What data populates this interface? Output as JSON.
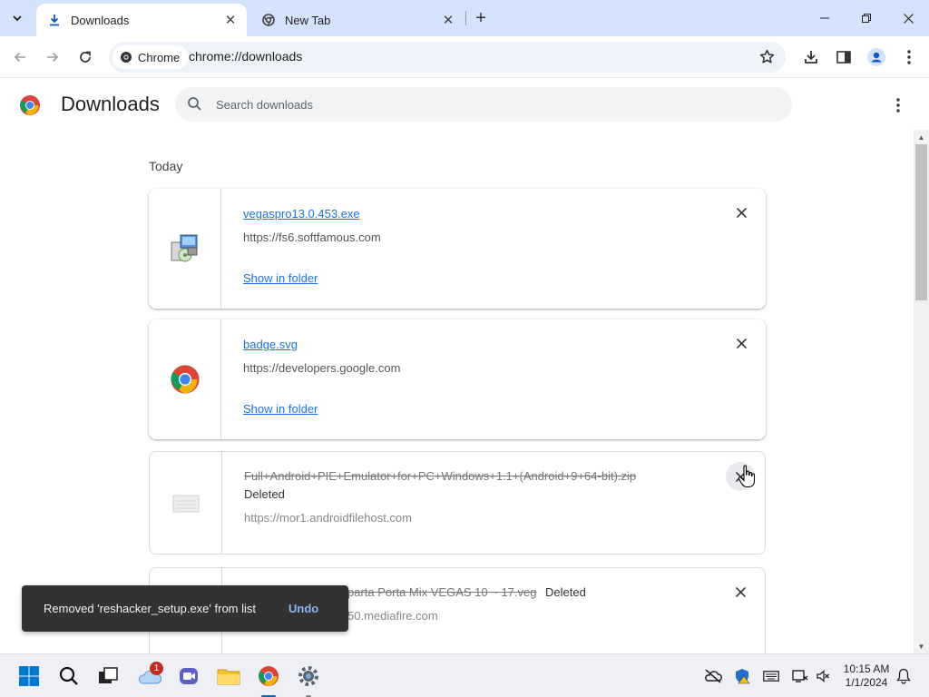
{
  "browser": {
    "tabs": [
      {
        "title": "Downloads",
        "active": true
      },
      {
        "title": "New Tab",
        "active": false
      }
    ],
    "omnibox": {
      "chip_label": "Chrome",
      "url": "chrome://downloads"
    }
  },
  "downloads_page": {
    "title": "Downloads",
    "search_placeholder": "Search downloads",
    "section_label": "Today",
    "items": [
      {
        "filename": "vegaspro13.0.453.exe",
        "source": "https://fs6.softfamous.com",
        "action": "Show in folder",
        "icon": "installer-icon",
        "deleted": false
      },
      {
        "filename": "badge.svg",
        "source": "https://developers.google.com",
        "action": "Show in folder",
        "icon": "chrome-icon",
        "deleted": false
      },
      {
        "filename": "Full+Android+PIE+Emulator+for+PC+Windows+1.1+(Android+9+64-bit).zip",
        "status": "Deleted",
        "source": "https://mor1.androidfilehost.com",
        "icon": "zip-icon",
        "deleted": true
      },
      {
        "filename_visible": "parta Porta Mix VEGAS 10 ~ 17.veg",
        "status": "Deleted",
        "source_visible": "50.mediafire.com",
        "deleted": true
      }
    ]
  },
  "toast": {
    "message": "Removed 'reshacker_setup.exe' from list",
    "action": "Undo"
  },
  "taskbar": {
    "notification_badge": "1",
    "clock_time": "10:15 AM",
    "clock_date": "1/1/2024"
  },
  "colors": {
    "accent": "#1a73e8",
    "tabstrip": "#d3e3fd",
    "toast_bg": "#323232",
    "undo": "#8ab4f8"
  }
}
